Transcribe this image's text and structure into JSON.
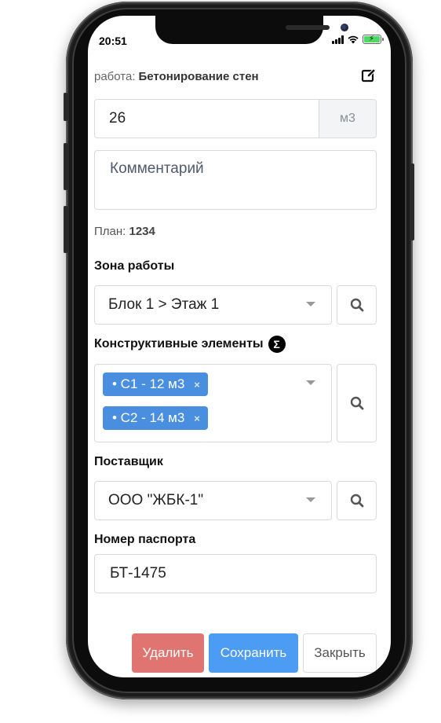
{
  "status_bar": {
    "time": "20:51"
  },
  "work": {
    "prefix": "работа:",
    "name": "Бетонирование стен"
  },
  "quantity": {
    "value": "26",
    "unit": "м3"
  },
  "comment": {
    "placeholder": "Комментарий"
  },
  "plan": {
    "label": "План:",
    "value": "1234"
  },
  "zone": {
    "label": "Зона работы",
    "selected": "Блок 1 > Этаж 1"
  },
  "elements": {
    "label": "Конструктивные элементы",
    "sigma_symbol": "Σ",
    "tags": [
      {
        "label": "• С1 - 12 м3"
      },
      {
        "label": "• С2 - 14 м3"
      }
    ],
    "remove_symbol": "×"
  },
  "supplier": {
    "label": "Поставщик",
    "selected": "ООО \"ЖБК-1\""
  },
  "passport": {
    "label": "Номер паспорта",
    "value": "БТ-1475"
  },
  "footer": {
    "delete_label": "Удалить",
    "save_label": "Сохранить",
    "close_label": "Закрыть"
  },
  "colors": {
    "delete": "#e07470",
    "save": "#4b9cf2",
    "tag": "#4a8ee0"
  },
  "icons": {
    "edit": "edit-icon",
    "search": "search-icon",
    "dropdown": "chevron-down-icon"
  }
}
